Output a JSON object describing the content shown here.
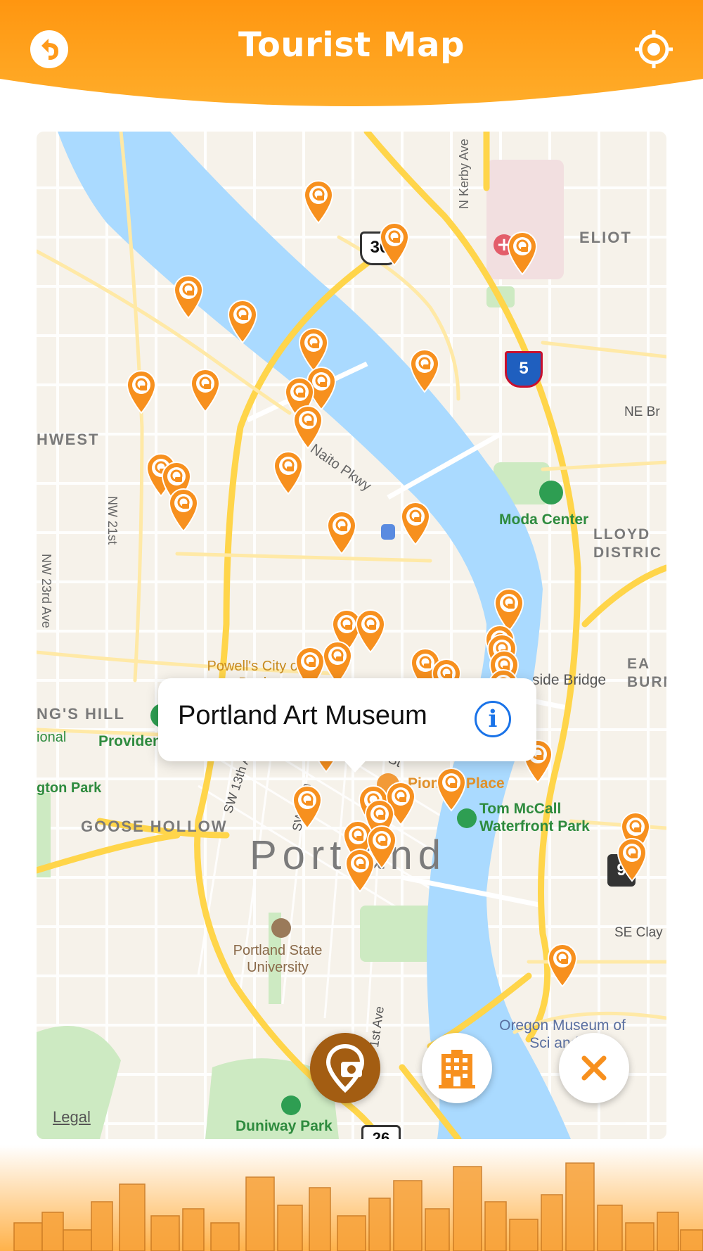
{
  "header": {
    "title": "Tourist Map",
    "back_icon": "back-arrow-icon",
    "locate_icon": "locate-crosshair-icon",
    "color_top": "#ff9a1a",
    "color_bottom": "#ffb22e"
  },
  "map": {
    "place_labels": {
      "eliot": "ELIOT",
      "moda_center": "Moda Center",
      "lloyd_district": "LLOYD DISTRIC",
      "ne_br": "NE Br",
      "northwest": "HWEST",
      "powells": "Powell's City of Book",
      "kings_hill": "NG'S HILL",
      "providence_park": "Providence Park",
      "pioneer_place": "Pioneer Place",
      "tom_mccall": "Tom McCall Waterfront Park",
      "goose_hollow": "GOOSE HOLLOW",
      "portland": "Portland",
      "portland_state": "Portland State University",
      "omsi": "Oregon Museum of Sci and In",
      "duniway_park": "Duniway Park",
      "se_clay": "SE Clay",
      "ington_park": "gton Park",
      "ional": "ional",
      "eastside_bridge": "side Bridge",
      "ea_burn": "EA BURN"
    },
    "street_labels": {
      "n_kerby": "N Kerby Ave",
      "naito": "Naito Pkwy",
      "nw_23rd": "NW 23rd Ave",
      "nw_21st": "NW 21st",
      "sw_washington": "SW Washington St",
      "sw_13th": "SW 13th Ave",
      "sw_10th": "SW 10th",
      "first_ave": "1st Ave"
    },
    "shields": {
      "us30": "30",
      "i5": "5",
      "us26": "26",
      "partial": "9"
    },
    "legal": "Legal",
    "water_color": "#aadaff",
    "pin_color": "#f7901e"
  },
  "callout": {
    "title": "Portland Art Museum",
    "info_icon": "info-icon",
    "info_glyph": "i"
  },
  "fabs": {
    "camera": "camera-pin-icon",
    "hotel": "hotel-building-icon",
    "close": "close-icon"
  }
}
